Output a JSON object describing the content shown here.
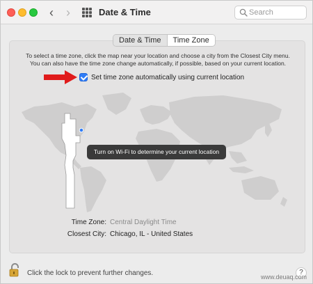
{
  "window": {
    "title": "Date & Time"
  },
  "toolbar": {
    "search_placeholder": "Search"
  },
  "tabs": [
    {
      "label": "Date & Time",
      "selected": false
    },
    {
      "label": "Time Zone",
      "selected": true
    }
  ],
  "instructions": {
    "line1": "To select a time zone, click the map near your location and choose a city from the Closest City menu.",
    "line2": "You can also have the time zone change automatically, if possible, based on your current location."
  },
  "auto_timezone": {
    "label": "Set time zone automatically using current location",
    "checked": true
  },
  "map": {
    "toast": "Turn on Wi-Fi to determine your current location"
  },
  "details": {
    "timezone_label": "Time Zone:",
    "timezone_value": "Central Daylight Time",
    "closest_city_label": "Closest City:",
    "closest_city_value": "Chicago, IL - United States"
  },
  "footer": {
    "lock_text": "Click the lock to prevent further changes.",
    "help": "?"
  },
  "watermark": "www.deuaq.com",
  "colors": {
    "accent": "#2f7cf6",
    "annotation_arrow": "#e01b1b",
    "timezone_band": "#ffffff"
  }
}
